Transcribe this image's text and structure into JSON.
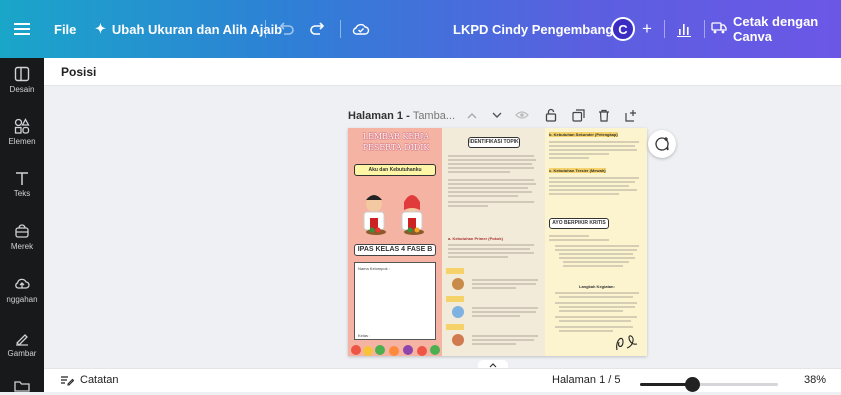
{
  "topbar": {
    "file_label": "File",
    "resize_label": "Ubah Ukuran dan Alih Ajaib",
    "doc_title": "LKPD Cindy Pengembangan",
    "avatar_letter": "C",
    "print_label": "Cetak dengan Canva"
  },
  "sidebar": {
    "items": [
      {
        "label": "Desain",
        "icon": "layout-icon"
      },
      {
        "label": "Elemen",
        "icon": "elements-icon"
      },
      {
        "label": "Teks",
        "icon": "text-icon"
      },
      {
        "label": "Merek",
        "icon": "brand-icon"
      },
      {
        "label": "nggahan",
        "icon": "upload-icon"
      },
      {
        "label": "Gambar",
        "icon": "draw-icon"
      }
    ]
  },
  "subbar": {
    "position_label": "Posisi"
  },
  "page_header": {
    "page_label": "Halaman 1 - ",
    "page_title_placeholder": "Tamba..."
  },
  "page_content": {
    "col1": {
      "title": "LEMBAR KERJA PESERTA DIDIK",
      "subtitle": "Aku dan Kebutuhanku",
      "badge": "IPAS KELAS 4 FASE B",
      "member_label": "Nama Kelompok :",
      "kelas_label": "Kelas :"
    },
    "col2": {
      "heading": "IDENTIFIKASI TOPIK",
      "section_primer": "a. Kebutuhan Primer (Pokok)"
    },
    "col3": {
      "heading_sekunder": "b. Kebutuhan Sekunder (Pelengkap)",
      "heading_tersier": "c. Kebutuhan Tersier (Mewah)",
      "ayo": "AYO BERPIKIR KRITIS",
      "kegiatan": "Langkah Kegiatan:"
    }
  },
  "bottombar": {
    "notes_label": "Catatan",
    "page_indicator": "Halaman 1 / 5",
    "zoom": "38%",
    "zoom_level": 0.38
  },
  "colors": {
    "sidebar_bg": "#18191b",
    "accent": "#6b57e6",
    "avatar_bg": "#3b2dc4"
  }
}
